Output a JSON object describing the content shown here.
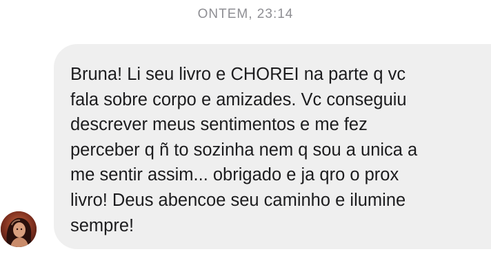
{
  "conversation": {
    "timestamp": "ONTEM, 23:14",
    "message": {
      "text": "Bruna! Li seu livro e CHOREI na parte q vc\nfala sobre corpo e amizades. Vc conseguiu\ndescrever meus sentimentos e me fez\nperceber q ñ to sozinha nem q sou a unica a\nme sentir assim... obrigado e ja qro o prox\nlivro! Deus abencoe seu caminho e ilumine\nsempre!"
    },
    "sender": {
      "avatar_icon": "profile-photo-avatar"
    }
  },
  "colors": {
    "bubble_background": "#efefef",
    "timestamp_text": "#8e8e93",
    "message_text": "#1c1c1e",
    "page_background": "#ffffff"
  }
}
